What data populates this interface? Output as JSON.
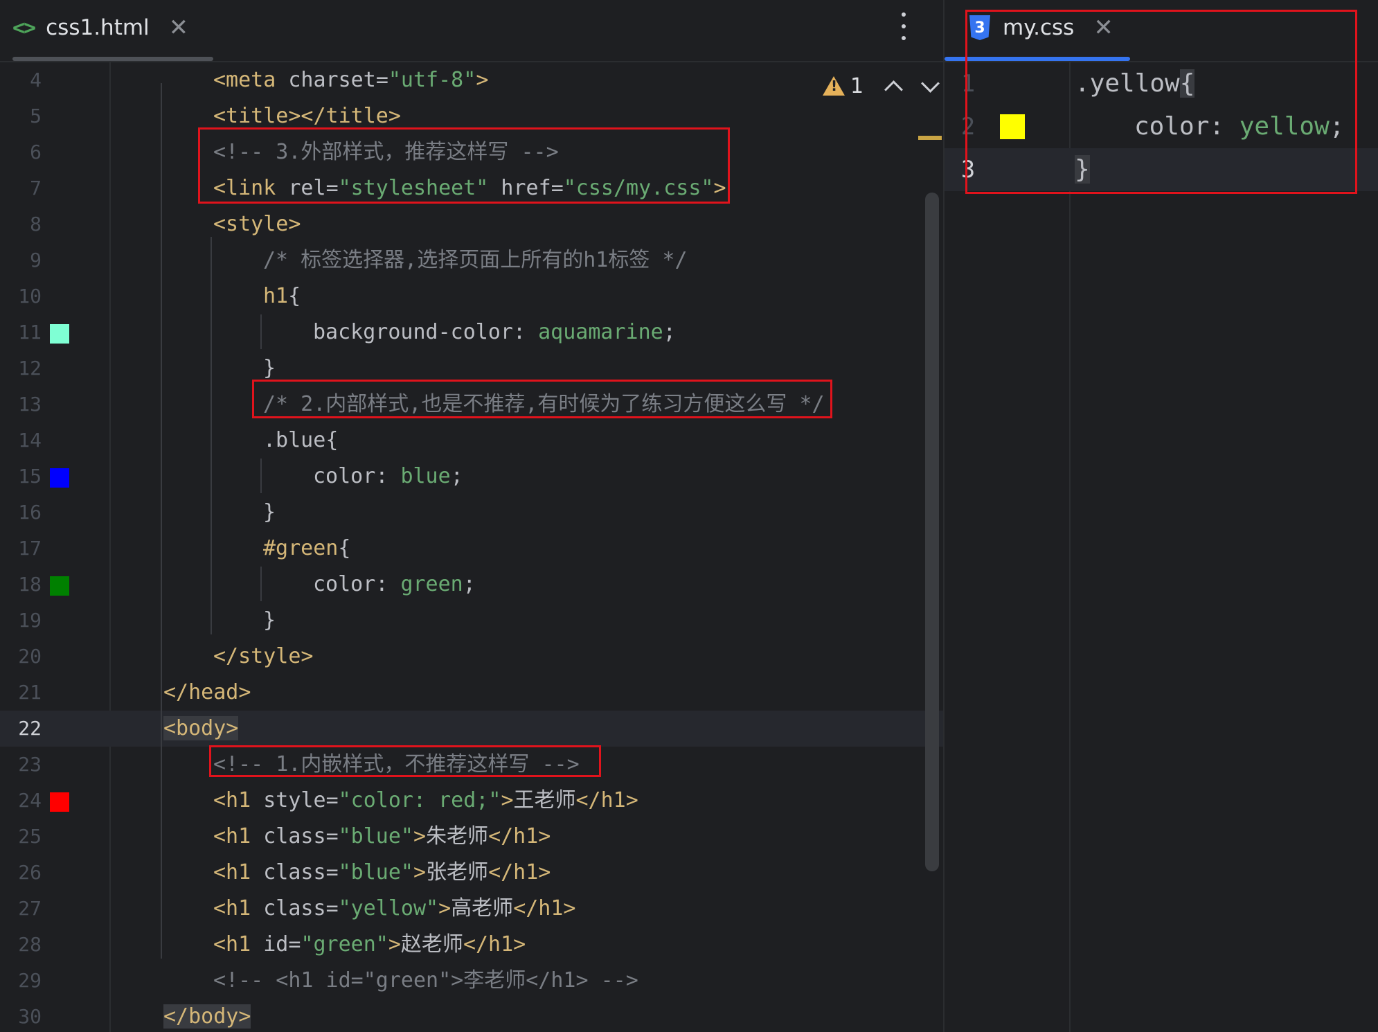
{
  "left_editor": {
    "tab": {
      "label": "css1.html",
      "icon": "html-file-icon"
    },
    "inspection": {
      "count": "1"
    },
    "lines": [
      {
        "n": "4",
        "segs": [
          [
            "tag",
            "<meta "
          ],
          [
            "attr",
            "charset"
          ],
          [
            "punc",
            "="
          ],
          [
            "str",
            "\"utf-8\""
          ],
          [
            "tag",
            ">"
          ]
        ]
      },
      {
        "n": "5",
        "segs": [
          [
            "tag",
            "<title></title>"
          ]
        ]
      },
      {
        "n": "6",
        "segs": [
          [
            "cmt",
            "<!-- 3.外部样式，推荐这样写 -->"
          ]
        ]
      },
      {
        "n": "7",
        "segs": [
          [
            "tag",
            "<link "
          ],
          [
            "attr",
            "rel"
          ],
          [
            "punc",
            "="
          ],
          [
            "str",
            "\"stylesheet\""
          ],
          [
            "attr",
            " href"
          ],
          [
            "punc",
            "="
          ],
          [
            "str",
            "\"css/my.css\""
          ],
          [
            "tag",
            ">"
          ]
        ]
      },
      {
        "n": "8",
        "segs": [
          [
            "tag",
            "<style>"
          ]
        ]
      },
      {
        "n": "9",
        "segs": [
          [
            "cmt",
            "/* 标签选择器,选择页面上所有的h1标签 */"
          ]
        ]
      },
      {
        "n": "10",
        "segs": [
          [
            "tag",
            "h1"
          ],
          [
            "brace",
            "{"
          ]
        ]
      },
      {
        "n": "11",
        "segs": [
          [
            "prop",
            "background-color"
          ],
          [
            "punc",
            ": "
          ],
          [
            "val",
            "aquamarine"
          ],
          [
            "punc",
            ";"
          ]
        ]
      },
      {
        "n": "12",
        "segs": [
          [
            "brace",
            "}"
          ]
        ]
      },
      {
        "n": "13",
        "segs": [
          [
            "cmt",
            "/* 2.内部样式,也是不推荐,有时候为了练习方便这么写 */"
          ]
        ]
      },
      {
        "n": "14",
        "segs": [
          [
            "sel",
            ".blue"
          ],
          [
            "brace",
            "{"
          ]
        ]
      },
      {
        "n": "15",
        "segs": [
          [
            "prop",
            "color"
          ],
          [
            "punc",
            ": "
          ],
          [
            "val",
            "blue"
          ],
          [
            "punc",
            ";"
          ]
        ]
      },
      {
        "n": "16",
        "segs": [
          [
            "brace",
            "}"
          ]
        ]
      },
      {
        "n": "17",
        "segs": [
          [
            "tag",
            "#green"
          ],
          [
            "brace",
            "{"
          ]
        ]
      },
      {
        "n": "18",
        "segs": [
          [
            "prop",
            "color"
          ],
          [
            "punc",
            ": "
          ],
          [
            "val",
            "green"
          ],
          [
            "punc",
            ";"
          ]
        ]
      },
      {
        "n": "19",
        "segs": [
          [
            "brace",
            "}"
          ]
        ]
      },
      {
        "n": "20",
        "segs": [
          [
            "tag",
            "</style>"
          ]
        ]
      },
      {
        "n": "21",
        "segs": [
          [
            "tag",
            "</head>"
          ]
        ]
      },
      {
        "n": "22",
        "segs": [
          [
            "tag",
            "<body>"
          ]
        ]
      },
      {
        "n": "23",
        "segs": [
          [
            "cmt",
            "<!-- 1.内嵌样式，不推荐这样写 -->"
          ]
        ]
      },
      {
        "n": "24",
        "segs": [
          [
            "tag",
            "<h1 "
          ],
          [
            "attr",
            "style"
          ],
          [
            "punc",
            "="
          ],
          [
            "str",
            "\"color: "
          ],
          [
            "val",
            "red"
          ],
          [
            "str",
            ";\""
          ],
          [
            "tag",
            ">"
          ],
          [
            "punc",
            "王老师"
          ],
          [
            "tag",
            "</h1>"
          ]
        ]
      },
      {
        "n": "25",
        "segs": [
          [
            "tag",
            "<h1 "
          ],
          [
            "attr",
            "class"
          ],
          [
            "punc",
            "="
          ],
          [
            "str",
            "\"blue\""
          ],
          [
            "tag",
            ">"
          ],
          [
            "punc",
            "朱老师"
          ],
          [
            "tag",
            "</h1>"
          ]
        ]
      },
      {
        "n": "26",
        "segs": [
          [
            "tag",
            "<h1 "
          ],
          [
            "attr",
            "class"
          ],
          [
            "punc",
            "="
          ],
          [
            "str",
            "\"blue\""
          ],
          [
            "tag",
            ">"
          ],
          [
            "punc",
            "张老师"
          ],
          [
            "tag",
            "</h1>"
          ]
        ]
      },
      {
        "n": "27",
        "segs": [
          [
            "tag",
            "<h1 "
          ],
          [
            "attr",
            "class"
          ],
          [
            "punc",
            "="
          ],
          [
            "str",
            "\"yellow\""
          ],
          [
            "tag",
            ">"
          ],
          [
            "punc",
            "高老师"
          ],
          [
            "tag",
            "</h1>"
          ]
        ]
      },
      {
        "n": "28",
        "segs": [
          [
            "tag",
            "<h1 "
          ],
          [
            "attr",
            "id"
          ],
          [
            "punc",
            "="
          ],
          [
            "str",
            "\"green\""
          ],
          [
            "tag",
            ">"
          ],
          [
            "punc",
            "赵老师"
          ],
          [
            "tag",
            "</h1>"
          ]
        ]
      },
      {
        "n": "29",
        "segs": [
          [
            "cmt",
            "<!-- <h1 id=\"green\">李老师</h1> -->"
          ]
        ]
      },
      {
        "n": "30",
        "segs": [
          [
            "tag",
            "</body>"
          ]
        ]
      }
    ],
    "swatches": {
      "11": "#7fffd4",
      "15": "#0000ff",
      "18": "#008000",
      "24": "#ff0000"
    }
  },
  "right_editor": {
    "tab": {
      "label": "my.css",
      "icon": "css-file-icon"
    },
    "lines": [
      {
        "n": "1",
        "segs": [
          [
            "sel",
            ".yellow"
          ],
          [
            "brace",
            "{"
          ]
        ]
      },
      {
        "n": "2",
        "segs": [
          [
            "prop",
            "color"
          ],
          [
            "punc",
            ": "
          ],
          [
            "val",
            "yellow"
          ],
          [
            "punc",
            ";"
          ]
        ]
      },
      {
        "n": "3",
        "segs": [
          [
            "brace",
            "}"
          ]
        ]
      }
    ],
    "swatches": {
      "2": "#ffff00"
    }
  },
  "colors": {
    "background": "#1e1f22",
    "highlight_box": "#e0131c",
    "accent": "#3574f0"
  }
}
